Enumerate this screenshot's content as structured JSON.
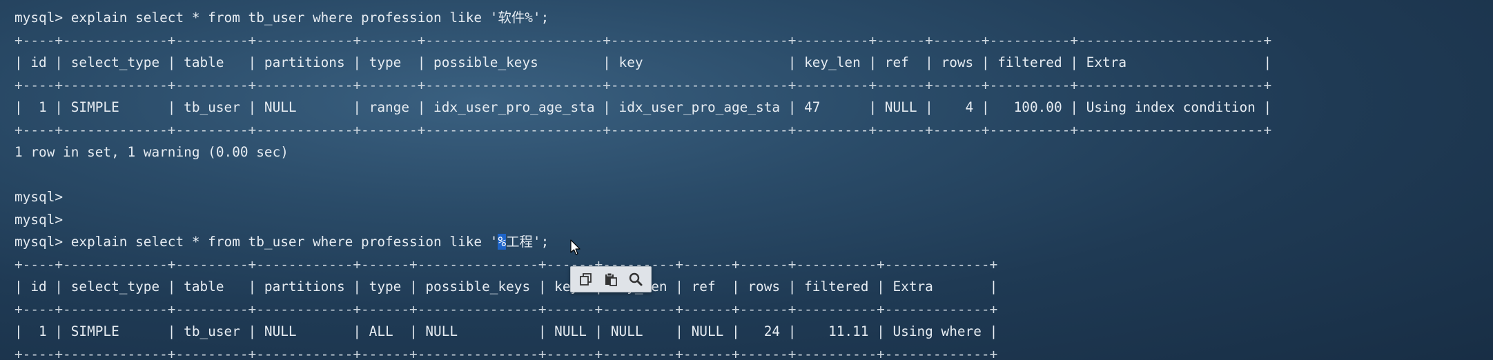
{
  "terminal": {
    "lines": [
      "mysql> explain select * from tb_user where profession like '软件%';",
      "+----+-------------+---------+------------+-------+----------------------+----------------------+---------+------+------+----------+-----------------------+",
      "| id | select_type | table   | partitions | type  | possible_keys        | key                  | key_len | ref  | rows | filtered | Extra                 |",
      "+----+-------------+---------+------------+-------+----------------------+----------------------+---------+------+------+----------+-----------------------+",
      "|  1 | SIMPLE      | tb_user | NULL       | range | idx_user_pro_age_sta | idx_user_pro_age_sta | 47      | NULL |    4 |   100.00 | Using index condition |",
      "+----+-------------+---------+------------+-------+----------------------+----------------------+---------+------+------+----------+-----------------------+",
      "1 row in set, 1 warning (0.00 sec)",
      "",
      "mysql>",
      "mysql>"
    ],
    "query2_prefix": "mysql> explain select * from tb_user where profession like '",
    "query2_selected": "%",
    "query2_suffix": "工程';",
    "lines2": [
      "+----+-------------+---------+------------+------+---------------+------+---------+------+------+----------+-------------+",
      "| id | select_type | table   | partitions | type | possible_keys | key  | key_len | ref  | rows | filtered | Extra       |",
      "+----+-------------+---------+------------+------+---------------+------+---------+------+------+----------+-------------+",
      "|  1 | SIMPLE      | tb_user | NULL       | ALL  | NULL          | NULL | NULL    | NULL |   24 |    11.11 | Using where |",
      "+----+-------------+---------+------------+------+---------------+------+---------+------+------+----------+-------------+"
    ]
  },
  "toolbar": {
    "buttons": [
      "copy-icon",
      "paste-icon",
      "search-icon"
    ]
  },
  "colors": {
    "background": "#1f3a54",
    "text": "#e6ecf2",
    "selection": "#1e64c8"
  }
}
